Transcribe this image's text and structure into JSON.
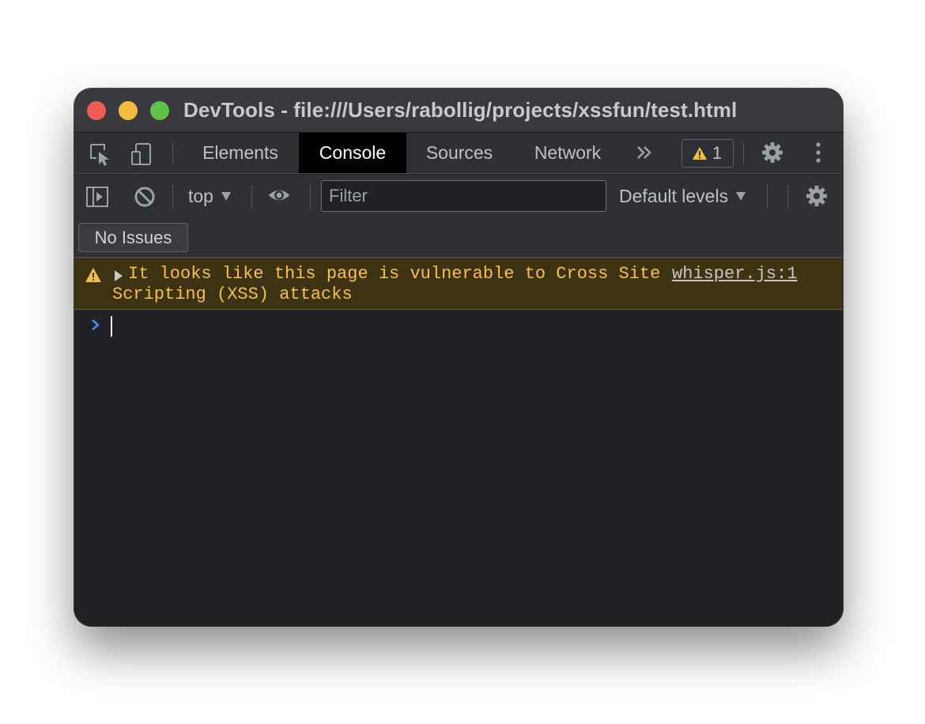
{
  "window": {
    "title": "DevTools - file:///Users/rabollig/projects/xssfun/test.html"
  },
  "tabs": [
    {
      "label": "Elements",
      "active": false
    },
    {
      "label": "Console",
      "active": true
    },
    {
      "label": "Sources",
      "active": false
    },
    {
      "label": "Network",
      "active": false
    }
  ],
  "issues_badge": {
    "count": "1",
    "icon": "warning-icon"
  },
  "console_toolbar": {
    "context": "top",
    "filter_placeholder": "Filter",
    "levels": "Default levels"
  },
  "issues_bar": {
    "label": "No Issues"
  },
  "messages": [
    {
      "level": "warning",
      "text_line1": "It looks like this page is vulnerable to Cross Site",
      "text_line2": "Scripting (XSS) attacks",
      "source": "whisper.js:1"
    }
  ],
  "colors": {
    "warning_text": "#f5c04f",
    "warning_background": "#3d3312",
    "active_tab": "#000000",
    "panel_background": "#202124",
    "prompt": "#4c8df6"
  }
}
